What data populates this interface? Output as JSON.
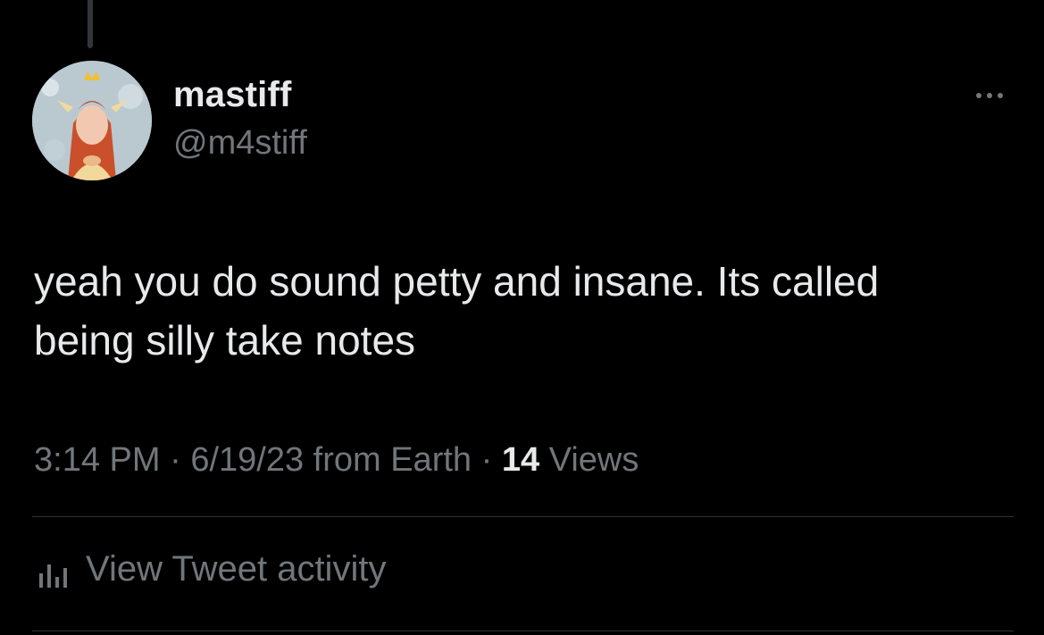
{
  "tweet": {
    "author": {
      "display_name": "mastiff",
      "handle": "@m4stiff",
      "avatar_icon": "user-avatar"
    },
    "text_line1": "yeah you do sound petty and insane. Its called",
    "text_line2": "being silly take notes",
    "time": "3:14 PM",
    "separator": "·",
    "date_source": "6/19/23 from Earth",
    "views_count": "14",
    "views_label": "Views",
    "more_icon": "more-horizontal-icon",
    "activity": {
      "icon": "bar-chart-icon",
      "label": "View Tweet activity"
    }
  },
  "colors": {
    "background": "#000000",
    "primary_text": "#e7e9ea",
    "secondary_text": "#71767b",
    "divider": "#2f3336"
  }
}
